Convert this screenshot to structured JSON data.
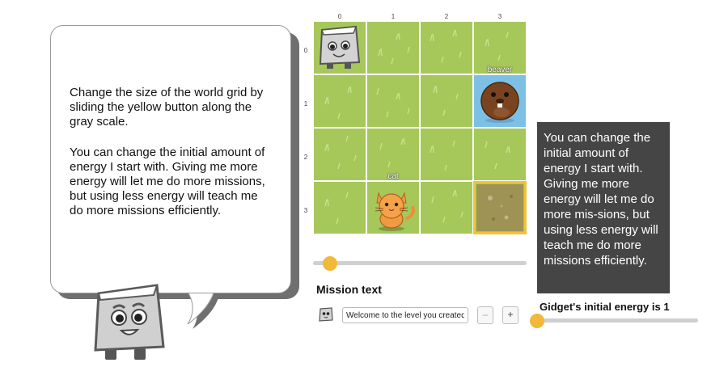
{
  "bubble": {
    "paragraph_1": "Change the size of the world grid by sliding the yellow button along the gray scale.",
    "paragraph_2": "You can change the initial amount of energy I start with. Giving me more energy will let me do more missions, but using less energy will teach me do more missions efficiently."
  },
  "grid": {
    "columns": [
      "0",
      "1",
      "2",
      "3"
    ],
    "rows": [
      "0",
      "1",
      "2",
      "3"
    ],
    "characters": {
      "beaver": "beaver",
      "cat": "cat"
    },
    "size_slider_value": 0
  },
  "mission": {
    "title": "Mission text",
    "input_value": "Welcome to the level you created!",
    "minus_label": "–",
    "plus_label": "+"
  },
  "tooltip": {
    "text": "You can change the initial amount of energy I start with. Giving me more energy will let me do more mis-sions, but using less energy will teach me do more missions efficiently."
  },
  "energy": {
    "label": "Gidget's initial energy is 1",
    "value": 1
  },
  "colors": {
    "grass": "#a6c75a",
    "water": "#7dc0e6",
    "slider_knob": "#f1b83a",
    "selection": "#f1c338",
    "tooltip_bg": "#454545"
  }
}
